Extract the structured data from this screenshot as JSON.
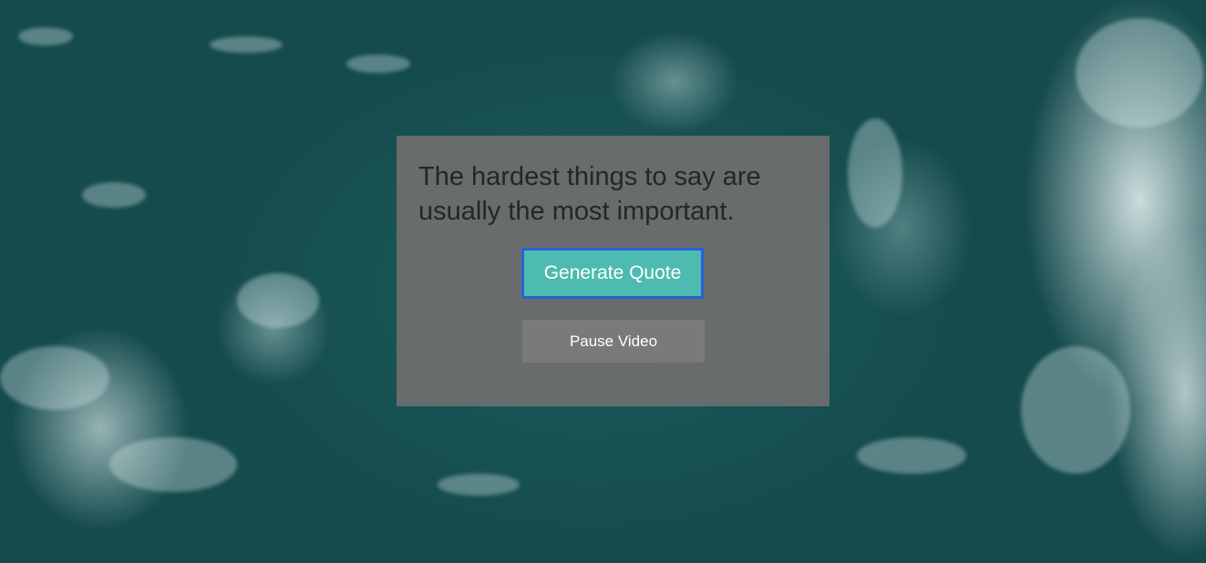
{
  "quote": {
    "text": "The hardest things to say are usually the most important."
  },
  "buttons": {
    "generate_label": "Generate Quote",
    "pause_label": "Pause Video"
  },
  "colors": {
    "accent": "#4dbbaf",
    "focus_ring": "#2c5fd6",
    "panel": "#6e6e6e",
    "secondary_button": "#7a7a7a",
    "quote_text": "#262626",
    "ocean": "#164c4f"
  }
}
